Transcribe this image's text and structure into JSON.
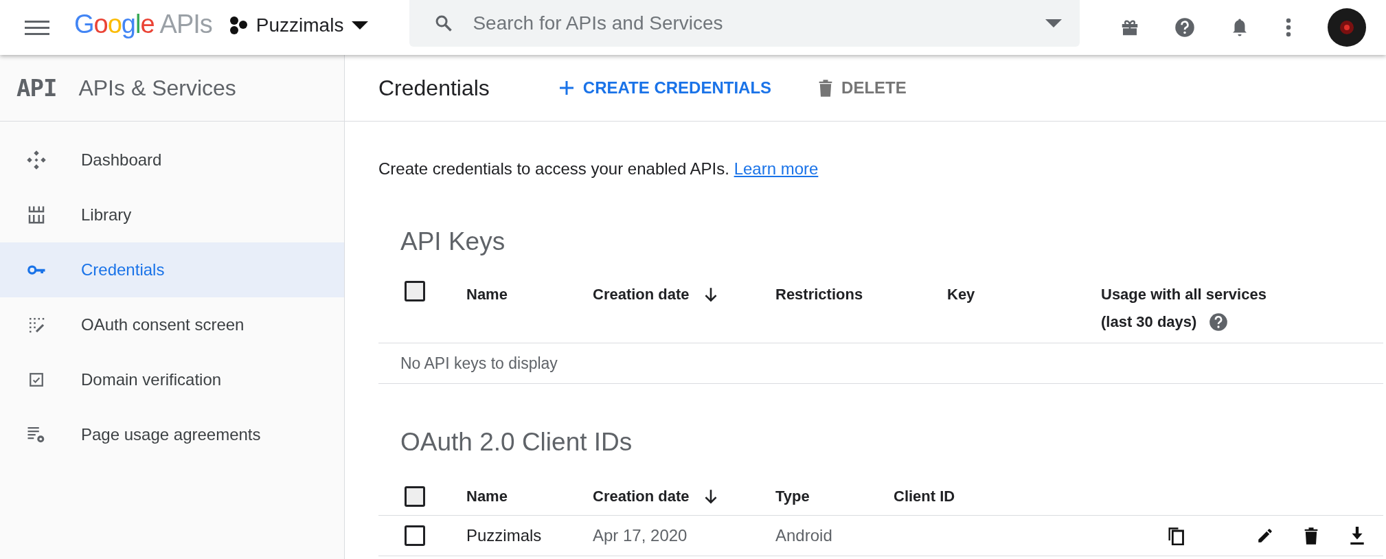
{
  "top_bar": {
    "logo": {
      "brand": "Google",
      "product": "APIs"
    },
    "project": "Puzzimals",
    "search": {
      "placeholder": "Search for APIs and Services"
    }
  },
  "sidebar": {
    "logo": "API",
    "title": "APIs & Services",
    "items": [
      {
        "label": "Dashboard",
        "kind": "dashboard",
        "selected": false
      },
      {
        "label": "Library",
        "kind": "library",
        "selected": false
      },
      {
        "label": "Credentials",
        "kind": "credentials",
        "selected": true
      },
      {
        "label": "OAuth consent screen",
        "kind": "consent",
        "selected": false
      },
      {
        "label": "Domain verification",
        "kind": "domain",
        "selected": false
      },
      {
        "label": "Page usage agreements",
        "kind": "agreements",
        "selected": false
      }
    ]
  },
  "content": {
    "title": "Credentials",
    "actions": [
      {
        "label": "CREATE CREDENTIALS",
        "kind": "create"
      },
      {
        "label": "DELETE",
        "kind": "delete"
      }
    ],
    "intro": {
      "text": "Create credentials to access your enabled APIs.",
      "link": "Learn more"
    },
    "api_keys": {
      "title": "API Keys",
      "select_all_checked": false,
      "columns": [
        {
          "lines": [
            "Name"
          ],
          "sorted": false,
          "help": false
        },
        {
          "lines": [
            "Creation date"
          ],
          "sorted": true,
          "help": false
        },
        {
          "lines": [
            "Restrictions"
          ],
          "sorted": false,
          "help": false
        },
        {
          "lines": [
            "Key"
          ],
          "sorted": false,
          "help": false
        },
        {
          "lines": [
            "Usage with all services",
            "(last 30 days)"
          ],
          "sorted": false,
          "help": true
        }
      ],
      "empty": "No API keys to display"
    },
    "oauth_clients": {
      "title": "OAuth 2.0 Client IDs",
      "select_all_checked": false,
      "columns": [
        {
          "label": "Name",
          "sorted": false
        },
        {
          "label": "Creation date",
          "sorted": true
        },
        {
          "label": "Type",
          "sorted": false
        },
        {
          "label": "Client ID",
          "sorted": false
        }
      ],
      "rows": [
        {
          "name": "Puzzimals",
          "date": "Apr 17, 2020",
          "type": "Android",
          "checked": false
        }
      ]
    }
  }
}
